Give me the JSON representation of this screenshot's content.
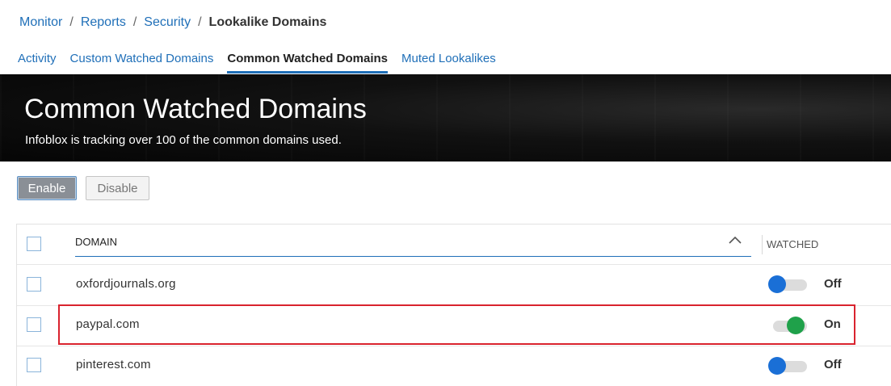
{
  "breadcrumb": {
    "items": [
      "Monitor",
      "Reports",
      "Security"
    ],
    "separator": "/",
    "current": "Lookalike Domains"
  },
  "tabs": [
    {
      "label": "Activity",
      "active": false
    },
    {
      "label": "Custom Watched Domains",
      "active": false
    },
    {
      "label": "Common Watched Domains",
      "active": true
    },
    {
      "label": "Muted Lookalikes",
      "active": false
    }
  ],
  "hero": {
    "title": "Common Watched Domains",
    "subtitle": "Infoblox is tracking over 100 of the common domains used."
  },
  "actions": {
    "enable_label": "Enable",
    "disable_label": "Disable"
  },
  "table": {
    "columns": {
      "domain": "DOMAIN",
      "watched": "WATCHED"
    },
    "sort": {
      "column": "domain",
      "direction": "ascending",
      "icon": "chevron-up-icon"
    },
    "rows": [
      {
        "domain": "oxfordjournals.org",
        "watched": false,
        "watched_label": "Off",
        "highlighted": false
      },
      {
        "domain": "paypal.com",
        "watched": true,
        "watched_label": "On",
        "highlighted": true
      },
      {
        "domain": "pinterest.com",
        "watched": false,
        "watched_label": "Off",
        "highlighted": false
      }
    ]
  },
  "colors": {
    "link": "#1f6fb8",
    "toggle_off_knob": "#1a6fd6",
    "toggle_on_knob": "#1fa14a",
    "highlight_border": "#d9232e",
    "hero_background": "#0a0a0a"
  }
}
